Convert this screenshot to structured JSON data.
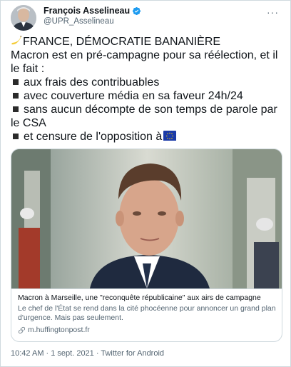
{
  "author": {
    "name": "François Asselineau",
    "handle": "@UPR_Asselineau",
    "verified": true
  },
  "tweet": {
    "line1": "FRANCE, DÉMOCRATIE BANANIÈRE",
    "line2": "Macron est en pré-campagne pour sa réélection, et il le fait :",
    "bullets": [
      "aux frais des contribuables",
      "avec couverture média en sa faveur 24h/24",
      "sans aucun décompte de son temps de parole par le CSA",
      "et censure de l'opposition à"
    ],
    "emoji": [
      "banana-emoji",
      "black-square-emoji",
      "eu-flag-emoji"
    ]
  },
  "card": {
    "title": "Macron à Marseille, une \"reconquête républicaine\" aux airs de campagne",
    "description": "Le chef de l'État se rend dans la cité phocéenne pour annoncer un grand plan d'urgence. Mais pas seulement.",
    "domain": "m.huffingtonpost.fr"
  },
  "meta": {
    "timestamp": "10:42 AM · 1 sept. 2021 · Twitter for Android"
  },
  "colors": {
    "text": "#0f1419",
    "secondary": "#536471",
    "verified": "#1d9bf0",
    "border": "#cfd9de"
  }
}
